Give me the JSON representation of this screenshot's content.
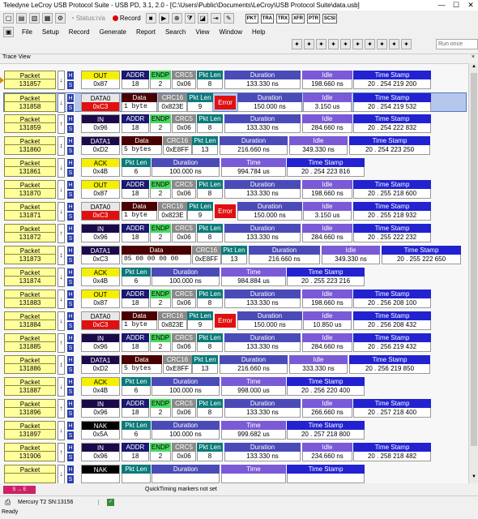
{
  "app": {
    "title": "Teledyne LeCroy USB Protocol Suite - USB PD, 3.1, 2.0 - [C:\\Users\\Public\\Documents\\LeCroy\\USB Protocol Suite\\data.usb]",
    "status_label": "Status:n/a",
    "record_label": "Record",
    "run_mode": "Run once"
  },
  "toolbar_pills": [
    "PKT",
    "TRA",
    "TRX",
    "XFR",
    "PTR",
    "SCSI"
  ],
  "menu": [
    "File",
    "Setup",
    "Record",
    "Generate",
    "Report",
    "Search",
    "View",
    "Window",
    "Help"
  ],
  "trace_view": {
    "title": "Trace View",
    "close": "×"
  },
  "packets": [
    {
      "num": "131857",
      "dir": "↓",
      "pid": "OUT",
      "pidval": "0x87",
      "type": "token",
      "addr": "18",
      "endp": "2",
      "crc": "0x06",
      "pktlen": "8",
      "duration": "133.330 ns",
      "idle": "198.660 ns",
      "ts": "20 . 254 219 200"
    },
    {
      "num": "131858",
      "dir": "↓",
      "pid": "DATA0",
      "pidval": "0xC3",
      "type": "data0err",
      "data": "1 byte",
      "crc": "0x823E",
      "pktlen": "9",
      "error": "Error",
      "duration": "150.000 ns",
      "idle": "3.150 us",
      "ts": "20 . 254 219 532",
      "selected": true
    },
    {
      "num": "131859",
      "dir": "↑",
      "pid": "IN",
      "pidval": "0x96",
      "type": "token",
      "addr": "18",
      "endp": "2",
      "crc": "0x06",
      "pktlen": "8",
      "duration": "133.330 ns",
      "idle": "284.660 ns",
      "ts": "20 . 254 222 832"
    },
    {
      "num": "131860",
      "dir": "↕",
      "pid": "DATA1",
      "pidval": "0xD2",
      "type": "data1",
      "data": "5 bytes",
      "crc": "0xE8FF",
      "pktlen": "13",
      "duration": "216.660 ns",
      "idle": "349.330 ns",
      "ts": "20 . 254 223 250"
    },
    {
      "num": "131861",
      "dir": "↓",
      "pid": "ACK",
      "pidval": "0x4B",
      "type": "hs",
      "pktlen": "6",
      "duration": "100.000 ns",
      "time": "994.784 us",
      "ts": "20 . 254 223 816"
    },
    {
      "num": "131870",
      "dir": "↓",
      "pid": "OUT",
      "pidval": "0x87",
      "type": "token",
      "addr": "18",
      "endp": "2",
      "crc": "0x06",
      "pktlen": "8",
      "duration": "133.330 ns",
      "idle": "198.660 ns",
      "ts": "20 . 255 218 600"
    },
    {
      "num": "131871",
      "dir": "↓",
      "pid": "DATA0",
      "pidval": "0xC3",
      "type": "data0err",
      "data": "1 byte",
      "crc": "0x823E",
      "pktlen": "9",
      "error": "Error",
      "duration": "150.000 ns",
      "idle": "3.150 us",
      "ts": "20 . 255 218 932"
    },
    {
      "num": "131872",
      "dir": "↑",
      "pid": "IN",
      "pidval": "0x96",
      "type": "token",
      "addr": "18",
      "endp": "2",
      "crc": "0x06",
      "pktlen": "8",
      "duration": "133.330 ns",
      "idle": "284.660 ns",
      "ts": "20 . 255 222 232"
    },
    {
      "num": "131873",
      "dir": "↕",
      "pid": "DATA1",
      "pidval": "0xC3",
      "type": "data1wide",
      "data": "05 00 00 00 00",
      "crc": "0xE8FF",
      "pktlen": "13",
      "duration": "216.660 ns",
      "idle": "349.330 ns",
      "ts": "20 . 255 222 650"
    },
    {
      "num": "131874",
      "dir": "↓",
      "pid": "ACK",
      "pidval": "0x4B",
      "type": "hs",
      "pktlen": "6",
      "duration": "100.000 ns",
      "time": "984.884 us",
      "ts": "20 . 255 223 216"
    },
    {
      "num": "131883",
      "dir": "↓",
      "pid": "OUT",
      "pidval": "0x87",
      "type": "token",
      "addr": "18",
      "endp": "2",
      "crc": "0x06",
      "pktlen": "8",
      "duration": "133.330 ns",
      "idle": "198.660 ns",
      "ts": "20 . 256 208 100"
    },
    {
      "num": "131884",
      "dir": "↓",
      "pid": "DATA0",
      "pidval": "0xC3",
      "type": "data0err",
      "data": "1 byte",
      "crc": "0x823E",
      "pktlen": "9",
      "error": "Error",
      "duration": "150.000 ns",
      "idle": "10.850 us",
      "ts": "20 . 256 208 432"
    },
    {
      "num": "131885",
      "dir": "↑",
      "pid": "IN",
      "pidval": "0x96",
      "type": "token",
      "addr": "18",
      "endp": "2",
      "crc": "0x06",
      "pktlen": "8",
      "duration": "133.330 ns",
      "idle": "284.660 ns",
      "ts": "20 . 256 219 432"
    },
    {
      "num": "131886",
      "dir": "↕",
      "pid": "DATA1",
      "pidval": "0xD2",
      "type": "data1",
      "data": "5 bytes",
      "crc": "0xE8FF",
      "pktlen": "13",
      "duration": "216.660 ns",
      "idle": "333.330 ns",
      "ts": "20 . 256 219 850"
    },
    {
      "num": "131887",
      "dir": "↓",
      "pid": "ACK",
      "pidval": "0x4B",
      "type": "hs",
      "pktlen": "6",
      "duration": "100.000 ns",
      "time": "998.000 us",
      "ts": "20 . 256 220 400"
    },
    {
      "num": "131896",
      "dir": "↑",
      "pid": "IN",
      "pidval": "0x96",
      "type": "token",
      "addr": "18",
      "endp": "2",
      "crc": "0x06",
      "pktlen": "8",
      "duration": "133.330 ns",
      "idle": "266.660 ns",
      "ts": "20 . 257 218 400"
    },
    {
      "num": "131897",
      "dir": "↓",
      "pid": "NAK",
      "pidval": "0x5A",
      "type": "hs",
      "pktlen": "6",
      "duration": "100.000 ns",
      "time": "999.682 us",
      "ts": "20 . 257 218 800"
    },
    {
      "num": "131906",
      "dir": "↑",
      "pid": "IN",
      "pidval": "0x96",
      "type": "token",
      "addr": "18",
      "endp": "2",
      "crc": "0x06",
      "pktlen": "8",
      "duration": "133.330 ns",
      "idle": "234.660 ns",
      "ts": "20 . 258 218 482"
    },
    {
      "num": "",
      "dir": "↓",
      "pid": "NAK",
      "pidval": "",
      "type": "hs",
      "pktlen": "",
      "duration": "",
      "time": "",
      "ts": ""
    }
  ],
  "labels": {
    "packet": "Packet",
    "addr": "ADDR",
    "endp": "ENDP",
    "crc5": "CRC5",
    "crc16": "CRC16",
    "pktlen": "Pkt Len",
    "duration": "Duration",
    "idle": "Idle",
    "time": "Time",
    "ts": "Time Stamp",
    "data": "Data",
    "h": "H",
    "s": "S"
  },
  "status": {
    "markers": "S → E",
    "quicktiming": "QuickTiming markers not set",
    "device": "Mercury T2 SN:13156",
    "ready": "Ready"
  }
}
